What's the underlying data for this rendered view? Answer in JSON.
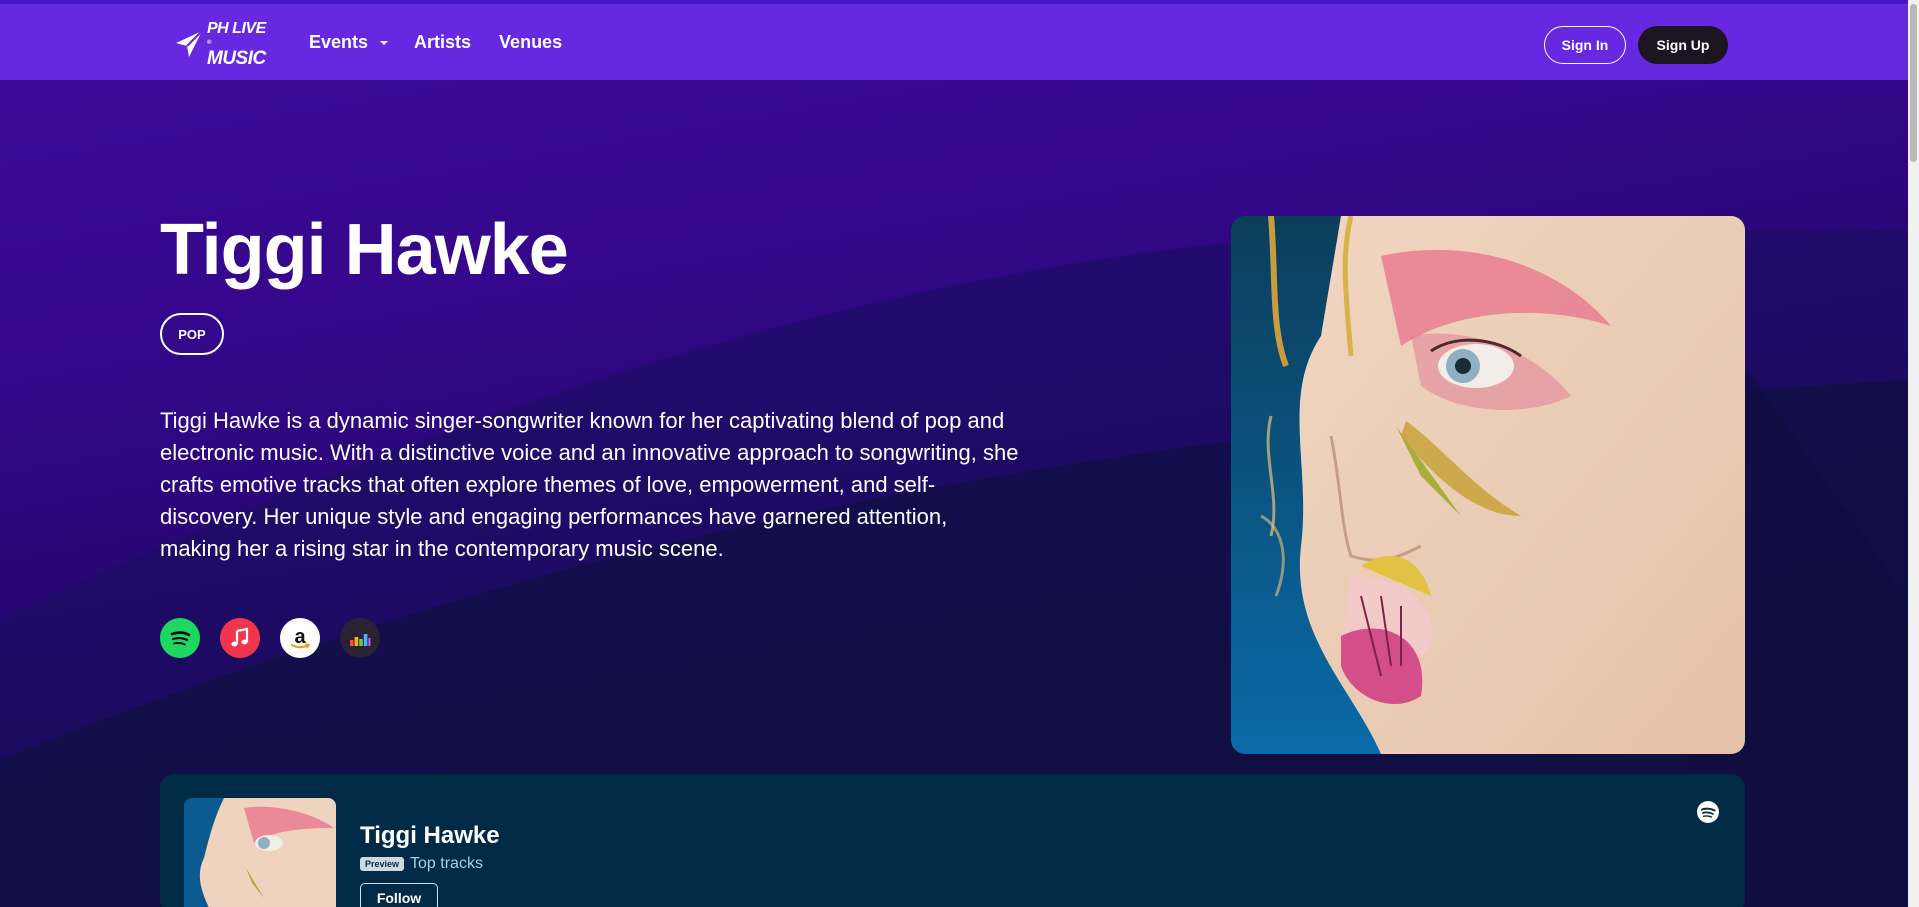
{
  "brand": {
    "logo_line1": "PH LIVE",
    "logo_line2": "MUSIC",
    "logo_mark": "®",
    "accent": "#6628e0"
  },
  "nav": {
    "events": "Events",
    "artists": "Artists",
    "venues": "Venues"
  },
  "auth": {
    "sign_in": "Sign In",
    "sign_up": "Sign Up"
  },
  "artist": {
    "name": "Tiggi Hawke",
    "genre": "POP",
    "bio": "Tiggi Hawke is a dynamic singer-songwriter known for her captivating blend of pop and electronic music. With a distinctive voice and an innovative approach to songwriting, she crafts emotive tracks that often explore themes of love, empowerment, and self-discovery. Her unique style and engaging performances have garnered attention, making her a rising star in the contemporary music scene."
  },
  "streaming_links": [
    {
      "service": "spotify",
      "icon": "spotify-icon",
      "color": "#1ed760"
    },
    {
      "service": "apple-music",
      "icon": "music-note-icon",
      "color": "#f0364d"
    },
    {
      "service": "amazon-music",
      "icon": "amazon-icon",
      "color": "#ffffff"
    },
    {
      "service": "deezer",
      "icon": "deezer-icon",
      "color": "#2a2233"
    }
  ],
  "embed": {
    "title": "Tiggi Hawke",
    "preview_badge": "Preview",
    "subtitle": "Top tracks",
    "follow": "Follow",
    "background": "#012a47"
  }
}
